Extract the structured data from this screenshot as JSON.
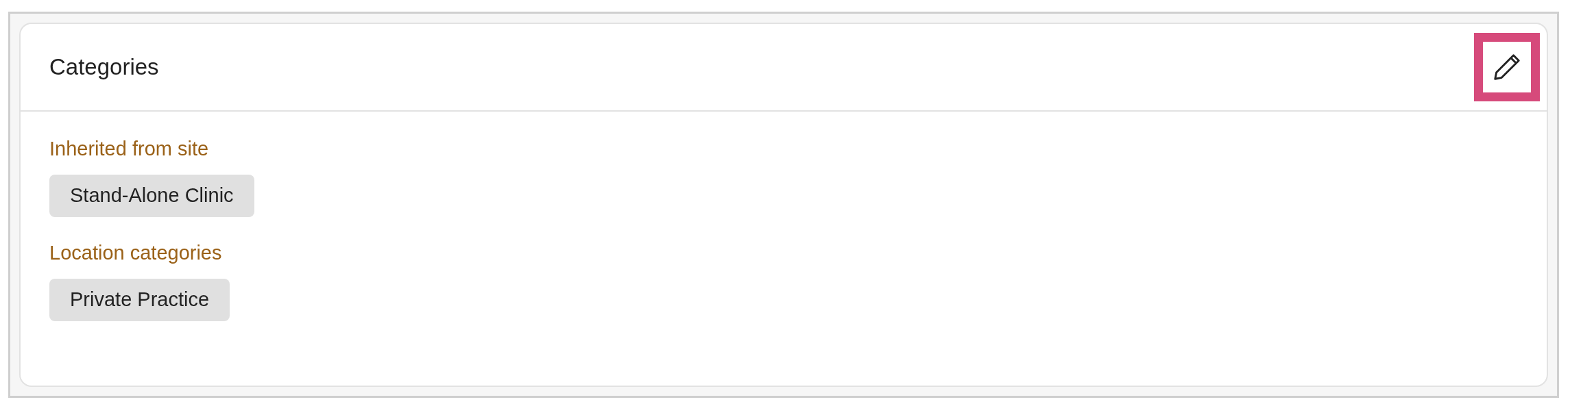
{
  "card": {
    "title": "Categories"
  },
  "sections": [
    {
      "heading": "Inherited from site",
      "tags": [
        "Stand-Alone Clinic"
      ]
    },
    {
      "heading": "Location categories",
      "tags": [
        "Private Practice"
      ]
    }
  ]
}
